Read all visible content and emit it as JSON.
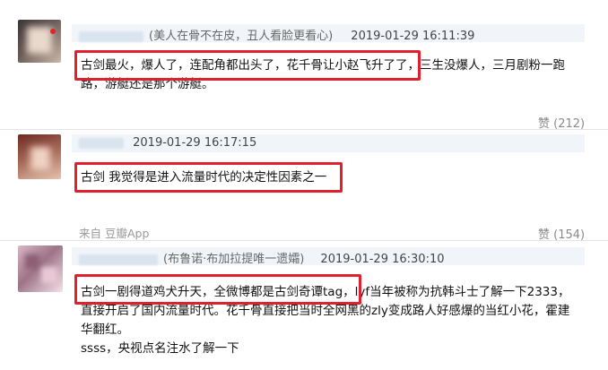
{
  "comments": [
    {
      "user_note": "(美人在骨不在皮，丑人看脸更看心)",
      "time": "2019-01-29 16:11:39",
      "lines": [
        "古剑最火，爆人了，连配角都出头了，花千骨让小赵飞升了了，三生没爆人，三月剧粉一跑",
        "路，游艇还是那个游艇。"
      ],
      "like": "赞 (212)"
    },
    {
      "user_note": "",
      "time": "2019-01-29 16:17:15",
      "lines": [
        "古剑 我觉得是进入流量时代的决定性因素之一"
      ],
      "source": "来自 豆瓣App",
      "like": "赞 (154)"
    },
    {
      "user_note": "(布鲁诺·布加拉提唯一遗孀)",
      "time": "2019-01-29 16:30:10",
      "lines": [
        "古剑一剧得道鸡犬升天，全微博都是古剑奇谭tag，lyf当年被称为抗韩斗士了解一下2333，",
        "直接开启了国内流量时代。花千骨直接把当时全网黑的zly变成路人好感爆的当红小花，霍建",
        "华翻红。",
        "ssss，央视点名注水了解一下"
      ]
    }
  ]
}
